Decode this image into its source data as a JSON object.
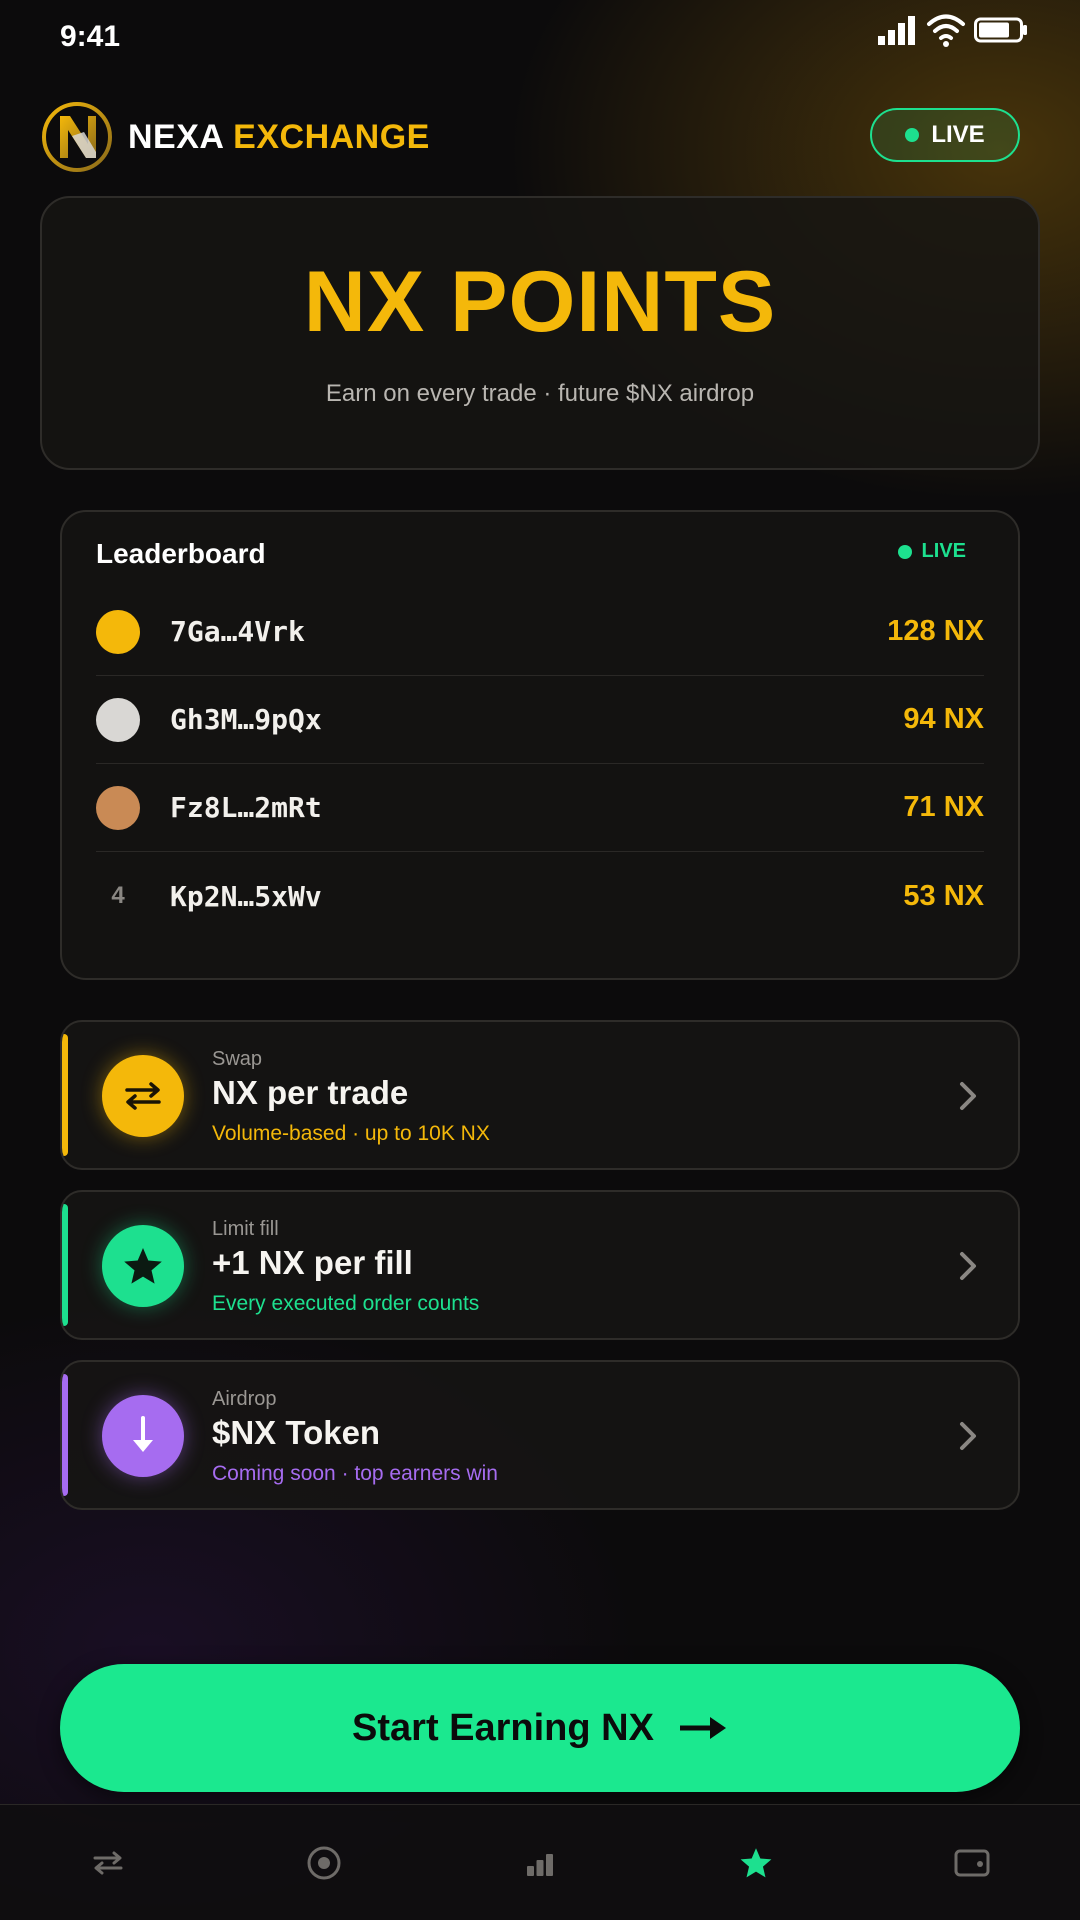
{
  "status_bar": {
    "time": "9:41"
  },
  "header": {
    "brand_main": "NEXA",
    "brand_accent": "EXCHANGE",
    "live_label": "LIVE"
  },
  "hero": {
    "title": "NX POINTS",
    "subtitle": "Earn on every trade · future $NX airdrop"
  },
  "leaderboard": {
    "title": "Leaderboard",
    "live_label": "LIVE",
    "rows": [
      {
        "rank": "1",
        "address": "7Ga…4Vrk",
        "points": "128 NX",
        "badge_color": "#f4b80a"
      },
      {
        "rank": "2",
        "address": "Gh3M…9pQx",
        "points": "94 NX",
        "badge_color": "#d9d7d4"
      },
      {
        "rank": "3",
        "address": "Fz8L…2mRt",
        "points": "71 NX",
        "badge_color": "#c98a55"
      },
      {
        "rank": "4",
        "address": "Kp2N…5xWv",
        "points": "53 NX"
      }
    ]
  },
  "cards": [
    {
      "kicker": "Swap",
      "title": "NX per trade",
      "desc": "Volume-based · up to 10K NX",
      "color": "#f4b80a",
      "icon": "swap-arrows-icon"
    },
    {
      "kicker": "Limit fill",
      "title": "+1 NX per fill",
      "desc": "Every executed order counts",
      "color": "#1de08f",
      "icon": "star-icon"
    },
    {
      "kicker": "Airdrop",
      "title": "$NX Token",
      "desc": "Coming soon · top earners win",
      "color": "#a66cf0",
      "icon": "download-arrow-icon"
    }
  ],
  "cta": {
    "label": "Start Earning NX"
  },
  "nav": {
    "items": [
      {
        "icon": "swap-icon",
        "active": false
      },
      {
        "icon": "target-icon",
        "active": false
      },
      {
        "icon": "chart-bars-icon",
        "active": false
      },
      {
        "icon": "star-icon",
        "active": true
      },
      {
        "icon": "wallet-icon",
        "active": false
      }
    ]
  },
  "colors": {
    "accent": "#f4b80a",
    "live": "#1de08f",
    "purple": "#a66cf0",
    "background": "#0c0b0c"
  }
}
